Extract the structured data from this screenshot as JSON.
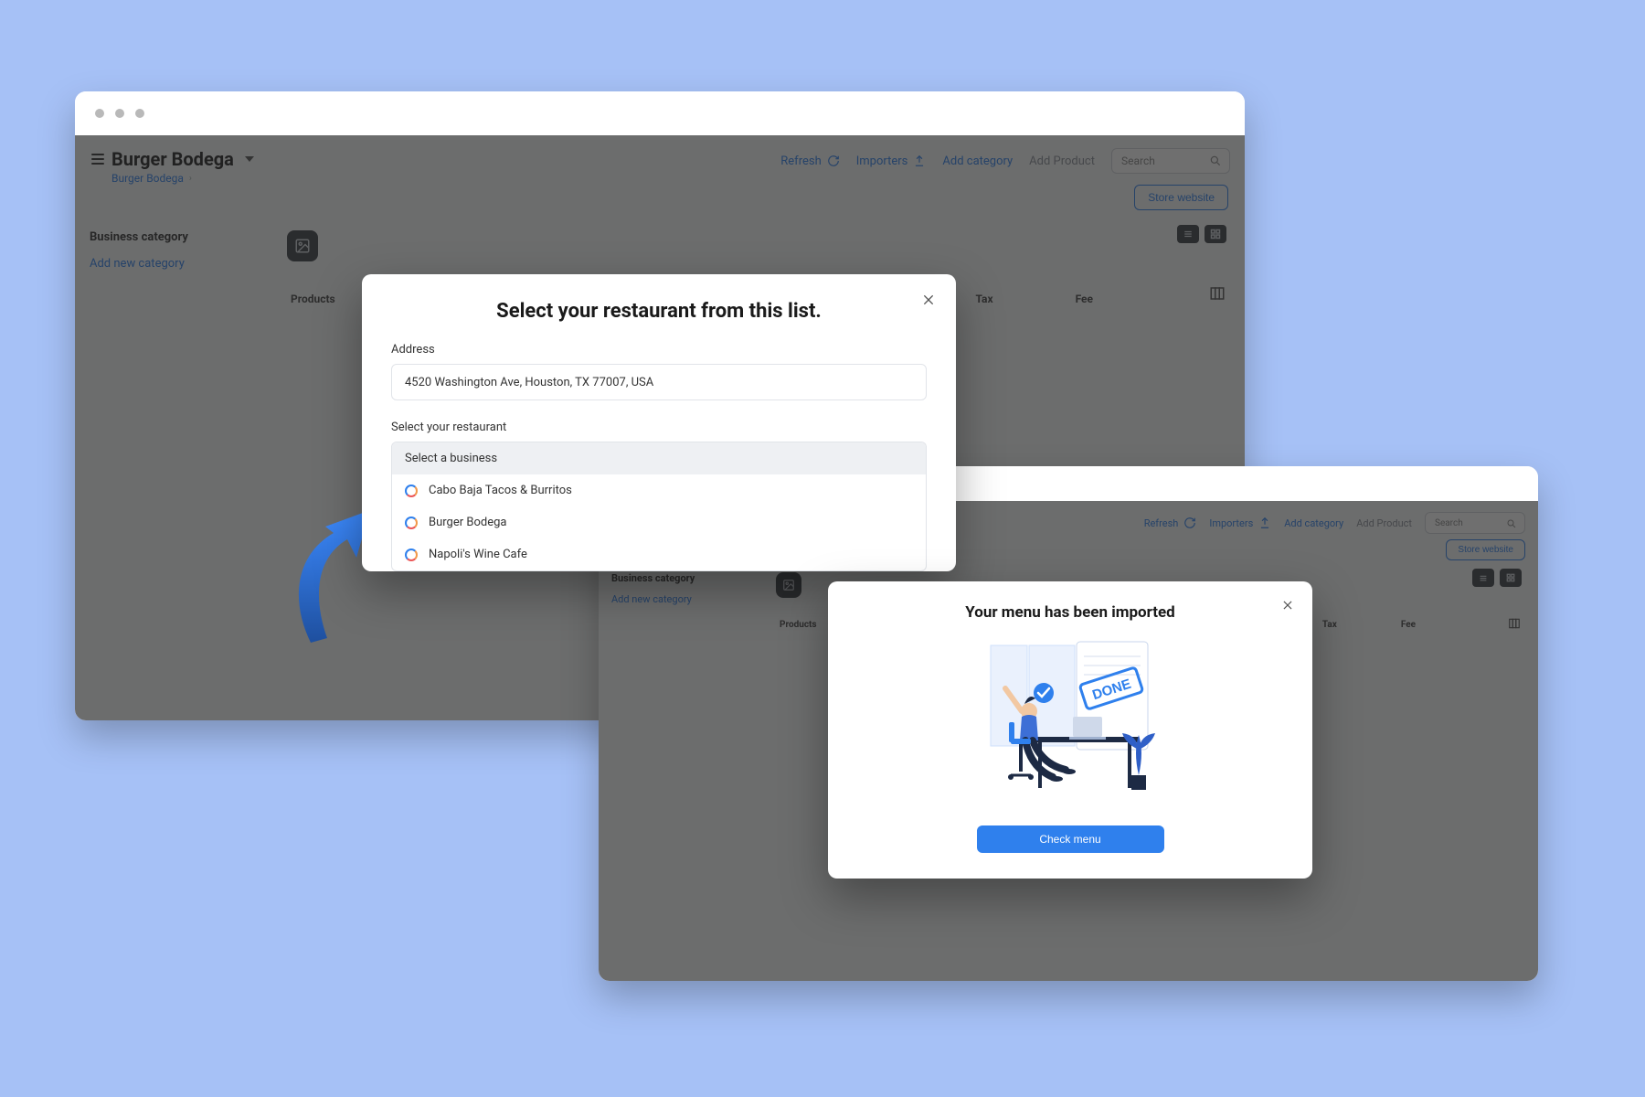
{
  "app": {
    "title": "Burger Bodega",
    "breadcrumb": "Burger Bodega",
    "toolbar": {
      "refresh": "Refresh",
      "importers": "Importers",
      "add_category": "Add category",
      "add_product": "Add Product",
      "search_placeholder": "Search"
    },
    "store_website": "Store website",
    "sidebar": {
      "heading": "Business category",
      "add_new": "Add new category"
    },
    "columns": {
      "products": "Products",
      "tax": "Tax",
      "fee": "Fee"
    }
  },
  "modal_select": {
    "title": "Select your restaurant from this list.",
    "address_label": "Address",
    "address_value": "4520 Washington Ave, Houston, TX 77007, USA",
    "select_label": "Select your restaurant",
    "dropdown_placeholder": "Select a business",
    "options": [
      "Cabo Baja Tacos & Burritos",
      "Burger Bodega",
      "Napoli's Wine Cafe"
    ]
  },
  "modal_done": {
    "title": "Your menu has been imported",
    "illustration_stamp": "DONE",
    "button": "Check menu"
  }
}
